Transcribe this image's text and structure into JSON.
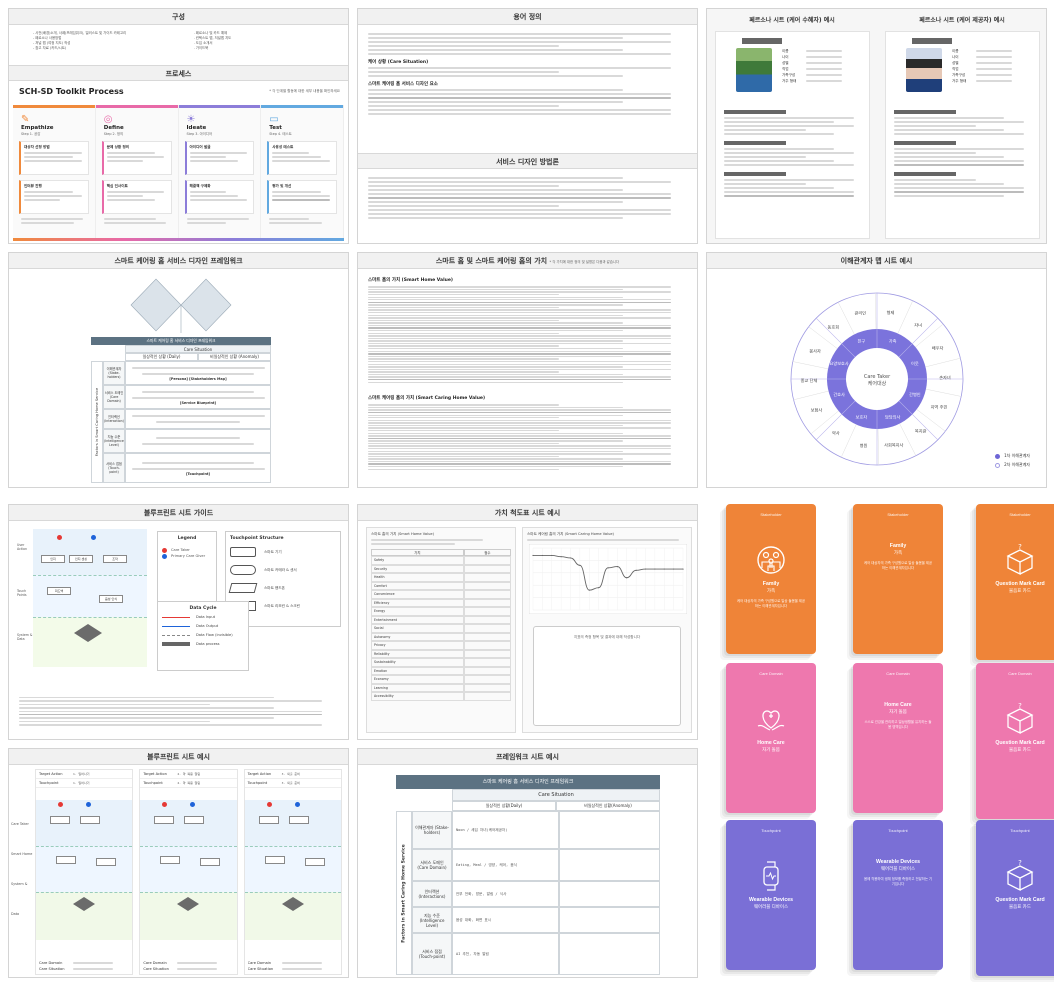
{
  "p1": {
    "title": "구성",
    "left_items": [
      "사전(배경)소개, 사례(프레임워크), 일러스트 및 가이드 카테고리",
      "페르소나 사용방법",
      "저널 맵 (여정 지도) 작성",
      "참고 자료 (카드/시트)"
    ],
    "right_items": [
      "페르소나 및 카드 예제",
      "컨텍스트 맵, 저널맵 지도",
      "도입 소개서",
      "가이드북"
    ],
    "section2": "프로세스",
    "process_title": "SCH-SD Toolkit Process",
    "process_note": "* 각 단계별 활동에 대한 세부 내용을 확인하세요",
    "phases": [
      {
        "name": "Empathize",
        "sub": "Step 1. 공감",
        "color": "#f08a3c",
        "icon": "✎"
      },
      {
        "name": "Define",
        "sub": "Step 2. 정의",
        "color": "#e86aa8",
        "icon": "◎"
      },
      {
        "name": "Ideate",
        "sub": "Step 3. 아이디어",
        "color": "#8c7dd9",
        "icon": "☀"
      },
      {
        "name": "Test",
        "sub": "Step 4. 테스트",
        "color": "#62a9e0",
        "icon": "▭"
      }
    ],
    "box_titles": [
      "대상자 선정 방법",
      "인터뷰 진행",
      "문제 상황 정의",
      "핵심 인사이트",
      "아이디어 발굴",
      "해결책 구체화",
      "사용성 테스트",
      "평가 및 개선"
    ]
  },
  "p2": {
    "title": "용어 정의",
    "title2": "서비스 디자인 방법론",
    "subheads": [
      "케어 상황 (Care Situation)",
      "스마트 케어링 홈 서비스 디자인 요소"
    ]
  },
  "p3": {
    "title_a": "페르소나 시트 (케어 수혜자) 예시",
    "title_b": "페르소나 시트 (케어 제공자) 예시",
    "fields": [
      "이름",
      "나이",
      "성별",
      "직업",
      "가족구성",
      "거주 형태"
    ]
  },
  "p4": {
    "title": "스마트 케어링 홈 서비스 디자인 프레임워크",
    "table_title": "스마트 케어링 홈 서비스 디자인 프레임워크",
    "col_main": "Care Situation",
    "cols": [
      "일상적인 상황 (Daily)",
      "비일상적인 상황 (Anomaly)"
    ],
    "rows": [
      "이해관계자 (Stake-holders)",
      "서비스 도메인 (Care Domain)",
      "인터랙션 (Interaction)",
      "지능 수준 (Intelligence Level)",
      "서비스 접점 (Touch-point)"
    ],
    "side_label": "Factors in Smart Caring Home Service",
    "tags": [
      "[Persona] [Stakeholders Map]",
      "[Touchpoint]",
      "[Service Blueprint]"
    ]
  },
  "p5": {
    "title": "스마트 홈 및 스마트 케어링 홈의 가치",
    "note": "* 각 가치에 대한 정의 및 설명은 다음과 같습니다",
    "section_a": "스마트 홈의 가치 (Smart Home Value)",
    "section_b": "스마트 케어링 홈의 가치 (Smart Caring Home Value)"
  },
  "p6": {
    "title": "이해관계자 맵 시트 예시",
    "center": "Care Taker 케어대상",
    "inner": [
      "가족",
      "이웃",
      "간병인",
      "담당의사",
      "보호자",
      "간호사",
      "요양보호사",
      "친구"
    ],
    "outer": [
      "형제",
      "자녀",
      "배우자",
      "손자녀",
      "지역 주민",
      "복지관",
      "사회복지사",
      "병원",
      "약사",
      "보험사",
      "종교 단체",
      "봉사자",
      "동호회",
      "관리인"
    ],
    "legend": [
      {
        "label": "1차 이해관계자",
        "color": "#6e66d6"
      },
      {
        "label": "2차 이해관계자",
        "color": "#c9c7ee"
      }
    ]
  },
  "p7": {
    "title": "블루프린트 시트 가이드",
    "legend_title": "Legend",
    "legend_items": [
      "Care Taker",
      "Primary Care Giver"
    ],
    "struct_title": "Touchpoint Structure",
    "struct_items": [
      "스마트 기기",
      "스마트 카메라 & 센서",
      "스마트 핸드폰",
      "스마트 리모컨 & 스크린"
    ],
    "flow_title": "Data Cycle",
    "flow_items": [
      "Data Input",
      "Data Output",
      "Data Flow (invisible)",
      "Data process"
    ],
    "lanes": [
      "User Action",
      "Touch Points",
      "System & Data"
    ],
    "nodes": [
      "인지",
      "인지 센싱",
      "조작",
      "피드백",
      "음성 인식"
    ]
  },
  "p8": {
    "title": "블루프린트 시트 예시",
    "lane_labels": [
      "Care Taker",
      "Smart Home",
      "System & Data"
    ],
    "rows": [
      "Target Action",
      "Touchpoint",
      "Care Domain",
      "Care Situation"
    ],
    "col_notes": [
      "1. 일어나기",
      "2. 약 복용 알림",
      "3. 외출 준비"
    ]
  },
  "p9": {
    "title": "가치 척도표 시트 예시",
    "left_title": "스마트 홈의 가치 (Smart Home Value)",
    "right_title": "스마트 케어링 홈의 가치 (Smart Caring Home Value)",
    "table_headers": [
      "가치",
      "점수"
    ],
    "table_rows": [
      "Safety",
      "Security",
      "Health",
      "Comfort",
      "Convenience",
      "Efficiency",
      "Energy",
      "Entertainment",
      "Social",
      "Autonomy",
      "Privacy",
      "Reliability",
      "Sustainability",
      "Emotion",
      "Economy",
      "Learning",
      "Accessibility"
    ],
    "box_text": "지표의 측정 항목 및 결과에 대해 작성합니다",
    "chart_data": {
      "type": "line",
      "title": "",
      "xlabel": "",
      "ylabel": "",
      "ylim": [
        0,
        5
      ],
      "x": [
        0,
        1,
        2,
        3,
        4,
        5,
        6,
        7,
        8,
        9,
        10,
        11,
        12,
        13,
        14,
        15,
        16
      ],
      "values": [
        4.4,
        4.4,
        4.4,
        4.3,
        4.2,
        3.6,
        1.6,
        1.8,
        3.4,
        3.5,
        2.6,
        3.2,
        3.3,
        3.3,
        3.3,
        3.3,
        3.3
      ]
    }
  },
  "p10": {
    "title": "프레임워크 시트 예시",
    "table_title": "스마트 케어링 홈 서비스 디자인 프레임워크",
    "col_main": "Care Situation",
    "cols": [
      "일상적인 상황(Daily)",
      "비일상적인 상황(Anomaly)"
    ],
    "rows": [
      "이해관계자 (Stake-holders)",
      "서비스 도메인 (Care Domain)",
      "인터랙션 (Interactions)",
      "지능 수준 (Intelligence Level)",
      "서비스 접점 (Touch-point)"
    ],
    "side_label": "Factors in Smart Caring Home Service",
    "notes": [
      "Noon / 세입 자녀(케어제공자)",
      "Eating, Meal / 영양, 케어, 음식",
      "안부 전화, 방문, 알림 / 식사",
      "음성 대화, 화면 표시",
      "AI 추천, 자동 알림",
      "스마트 스피커, 스마트폰, 냉장고"
    ]
  },
  "cards": [
    {
      "cat": "Stakeholder",
      "name": "Family",
      "kr": "가족",
      "desc": "케어 대상자의 가족 구성원으로 일상 돌봄을 제공하는 이해관계자입니다",
      "color": "#ef8438",
      "icon": "family"
    },
    {
      "cat": "Stakeholder",
      "name": "Family",
      "kr": "가족",
      "desc": "케어 대상자의 가족 구성원으로 일상 돌봄을 제공하는 이해관계자입니다",
      "color": "#ef8438",
      "icon": "none"
    },
    {
      "cat": "Stakeholder",
      "name": "Question Mark Card",
      "kr": "물음표 카드",
      "desc": "",
      "color": "#ef8438",
      "icon": "box"
    },
    {
      "cat": "Care Domain",
      "name": "Home Care",
      "kr": "자기 돌봄",
      "desc": "",
      "color": "#ee78ae",
      "icon": "care"
    },
    {
      "cat": "Care Domain",
      "name": "Home Care",
      "kr": "자기 돌봄",
      "desc": "스스로 건강을 관리하고 일상생활을 유지하는 돌봄 영역입니다",
      "color": "#ee78ae",
      "icon": "none"
    },
    {
      "cat": "Care Domain",
      "name": "Question Mark Card",
      "kr": "물음표 카드",
      "desc": "",
      "color": "#ee78ae",
      "icon": "box"
    },
    {
      "cat": "Touchpoint",
      "name": "Wearable Devices",
      "kr": "웨어러블 디바이스",
      "desc": "",
      "color": "#7a6fd6",
      "icon": "wear"
    },
    {
      "cat": "Touchpoint",
      "name": "Wearable Devices",
      "kr": "웨어러블 디바이스",
      "desc": "몸에 착용하여 생체 정보를 측정하고 전달하는 기기입니다",
      "color": "#7a6fd6",
      "icon": "none"
    },
    {
      "cat": "Touchpoint",
      "name": "Question Mark Card",
      "kr": "물음표 카드",
      "desc": "",
      "color": "#7a6fd6",
      "icon": "box"
    }
  ]
}
